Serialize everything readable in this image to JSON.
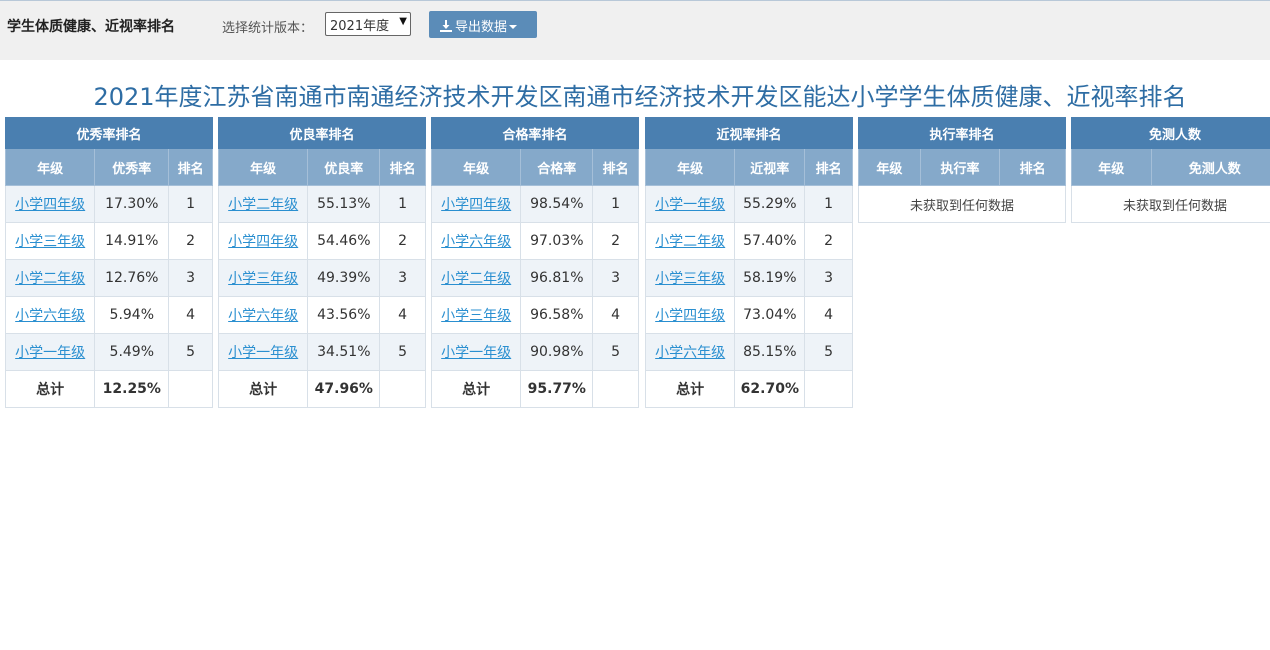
{
  "header": {
    "title": "学生体质健康、近视率排名",
    "version_label": "选择统计版本：",
    "version_selected": "2021年度",
    "export_label": "导出数据"
  },
  "report_title": "2021年度江苏省南通市南通经济技术开发区南通市经济技术开发区能达小学学生体质健康、近视率排名",
  "tables": [
    {
      "title": "优秀率排名",
      "headers": [
        "年级",
        "优秀率",
        "排名"
      ],
      "rows": [
        [
          "小学四年级",
          "17.30%",
          "1"
        ],
        [
          "小学三年级",
          "14.91%",
          "2"
        ],
        [
          "小学二年级",
          "12.76%",
          "3"
        ],
        [
          "小学六年级",
          "5.94%",
          "4"
        ],
        [
          "小学一年级",
          "5.49%",
          "5"
        ]
      ],
      "total": [
        "总计",
        "12.25%",
        ""
      ]
    },
    {
      "title": "优良率排名",
      "headers": [
        "年级",
        "优良率",
        "排名"
      ],
      "rows": [
        [
          "小学二年级",
          "55.13%",
          "1"
        ],
        [
          "小学四年级",
          "54.46%",
          "2"
        ],
        [
          "小学三年级",
          "49.39%",
          "3"
        ],
        [
          "小学六年级",
          "43.56%",
          "4"
        ],
        [
          "小学一年级",
          "34.51%",
          "5"
        ]
      ],
      "total": [
        "总计",
        "47.96%",
        ""
      ]
    },
    {
      "title": "合格率排名",
      "headers": [
        "年级",
        "合格率",
        "排名"
      ],
      "rows": [
        [
          "小学四年级",
          "98.54%",
          "1"
        ],
        [
          "小学六年级",
          "97.03%",
          "2"
        ],
        [
          "小学二年级",
          "96.81%",
          "3"
        ],
        [
          "小学三年级",
          "96.58%",
          "4"
        ],
        [
          "小学一年级",
          "90.98%",
          "5"
        ]
      ],
      "total": [
        "总计",
        "95.77%",
        ""
      ]
    },
    {
      "title": "近视率排名",
      "headers": [
        "年级",
        "近视率",
        "排名"
      ],
      "rows": [
        [
          "小学一年级",
          "55.29%",
          "1"
        ],
        [
          "小学二年级",
          "57.40%",
          "2"
        ],
        [
          "小学三年级",
          "58.19%",
          "3"
        ],
        [
          "小学四年级",
          "73.04%",
          "4"
        ],
        [
          "小学六年级",
          "85.15%",
          "5"
        ]
      ],
      "total": [
        "总计",
        "62.70%",
        ""
      ]
    },
    {
      "title": "执行率排名",
      "headers": [
        "年级",
        "执行率",
        "排名"
      ],
      "empty_text": "未获取到任何数据"
    },
    {
      "title": "免测人数",
      "headers": [
        "年级",
        "免测人数"
      ],
      "empty_text": "未获取到任何数据"
    }
  ],
  "colors": {
    "title_blue": "#2e6da4",
    "header_dark": "#4a7fb0",
    "header_light": "#85a9ca",
    "link": "#2a8fd0",
    "total_row": "#c8d8e8"
  }
}
